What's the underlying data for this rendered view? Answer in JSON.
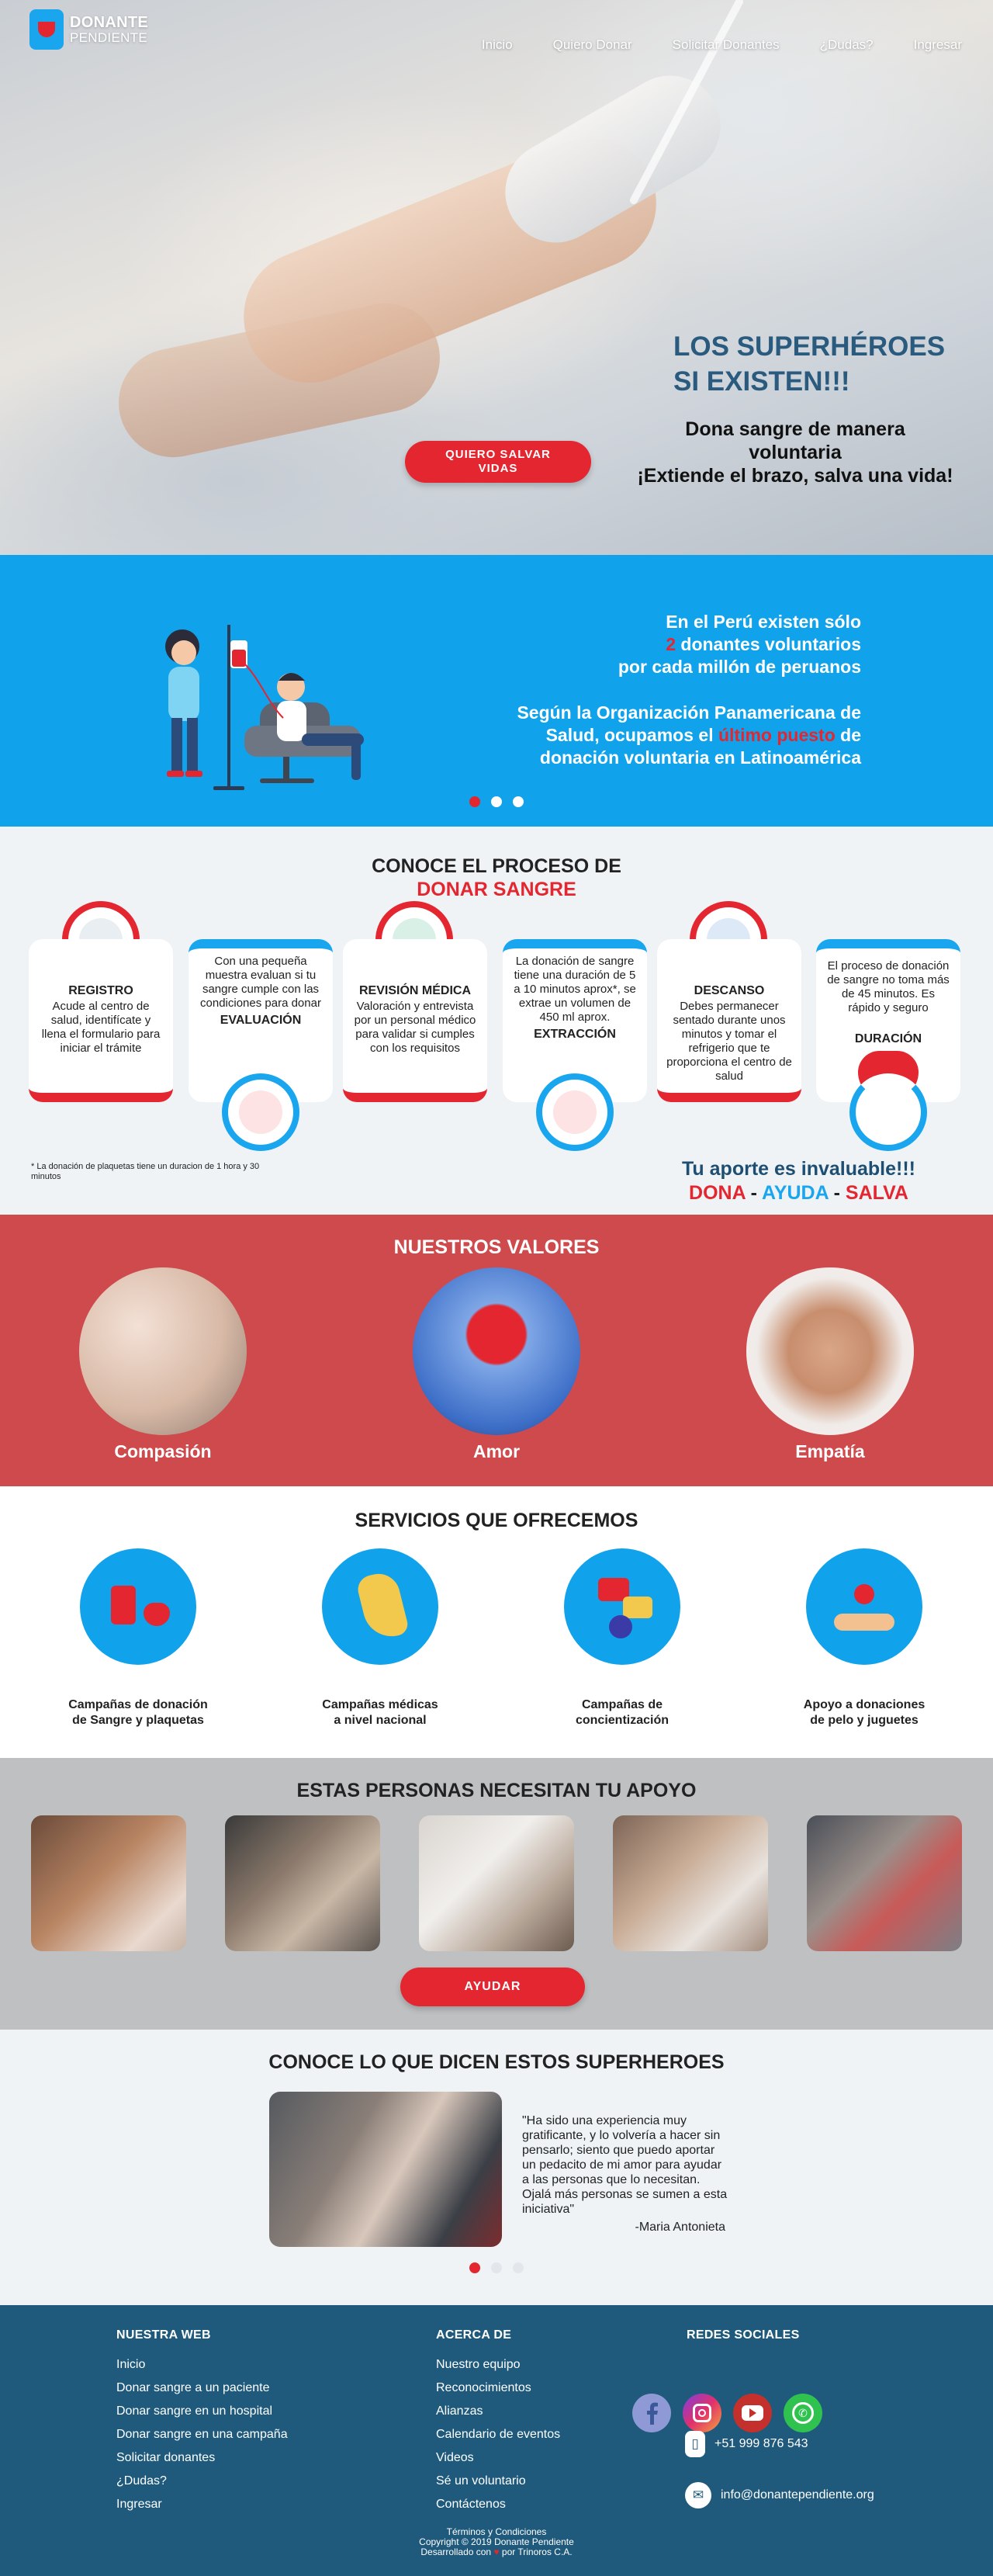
{
  "brand": {
    "line1": "DONANTE",
    "line2": "PENDIENTE"
  },
  "nav": [
    "Inicio",
    "Quiero Donar",
    "Solicitar Donantes",
    "¿Dudas?",
    "Ingresar"
  ],
  "hero": {
    "title_l1": "LOS SUPERHÉROES",
    "title_l2": "SI EXISTEN!!!",
    "sub_l1": "Dona sangre de manera",
    "sub_l2": "voluntaria",
    "sub_l3": "¡Extiende el brazo, salva una vida!",
    "button_l1": "QUIERO SALVAR",
    "button_l2": "VIDAS"
  },
  "stats": {
    "p1_a": "En el Perú existen sólo",
    "p1_num": "2",
    "p1_b": " donantes voluntarios",
    "p1_c": "por cada millón de peruanos",
    "p2_a": "Según la Organización Panamericana de",
    "p2_b": "Salud, ocupamos el ",
    "p2_hl": "último puesto",
    "p2_c": " de",
    "p2_d": "donación voluntaria en Latinoamérica"
  },
  "process": {
    "title_l1": "CONOCE EL PROCESO DE",
    "title_l2": "DONAR SANGRE",
    "steps": [
      {
        "title": "REGISTRO",
        "text": "Acude al centro de salud, identifícate y llena el formulario para iniciar el trámite"
      },
      {
        "title": "EVALUACIÓN",
        "text": "Con una pequeña muestra evaluan si tu sangre cumple con las condiciones para donar"
      },
      {
        "title": "REVISIÓN MÉDICA",
        "text": "Valoración y entrevista por un personal médico para validar si cumples con los requisitos"
      },
      {
        "title": "EXTRACCIÓN",
        "text": "La donación de sangre tiene una duración de 5 a 10 minutos aprox*, se extrae un volumen de 450 ml aprox."
      },
      {
        "title": "DESCANSO",
        "text": "Debes permanecer sentado durante unos minutos y tomar el refrigerio que te proporciona el centro de salud"
      },
      {
        "title": "DURACIÓN",
        "text": "El proceso de donación de sangre no toma más de 45 minutos. Es rápido y seguro"
      }
    ],
    "note": "* La donación de plaquetas tiene un duracion de 1 hora y 30 minutos",
    "aporte_l1": "Tu aporte es invaluable!!!",
    "aporte_w1": "DONA",
    "aporte_w2": "AYUDA",
    "aporte_w3": "SALVA",
    "aporte_sep": " - "
  },
  "values": {
    "title": "NUESTROS VALORES",
    "items": [
      "Compasión",
      "Amor",
      "Empatía"
    ]
  },
  "services": {
    "title": "SERVICIOS QUE OFRECEMOS",
    "items": [
      {
        "l1": "Campañas de donación",
        "l2": "de Sangre y plaquetas"
      },
      {
        "l1": "Campañas médicas",
        "l2": "a nivel nacional"
      },
      {
        "l1": "Campañas de",
        "l2": "concientización"
      },
      {
        "l1": "Apoyo a donaciones",
        "l2": "de pelo y juguetes"
      }
    ]
  },
  "people": {
    "title": "ESTAS PERSONAS NECESITAN TU APOYO",
    "button": "AYUDAR"
  },
  "testimonials": {
    "title": "CONOCE LO QUE DICEN ESTOS SUPERHEROES",
    "quote": "\"Ha sido una experiencia muy gratificante, y lo volvería a hacer sin pensarlo; siento que puedo aportar un pedacito de mi amor para ayudar a las personas que lo necesitan. Ojalá más personas se sumen a esta iniciativa\"",
    "author": "-Maria Antonieta"
  },
  "footer": {
    "col1_title": "NUESTRA WEB",
    "col1": [
      "Inicio",
      "Donar sangre a un paciente",
      "Donar sangre en un hospital",
      "Donar sangre en una campaña",
      "Solicitar donantes",
      "¿Dudas?",
      "Ingresar"
    ],
    "col2_title": "ACERCA DE",
    "col2": [
      "Nuestro equipo",
      "Reconocimientos",
      "Alianzas",
      "Calendario de eventos",
      "Videos",
      "Sé un voluntario",
      "Contáctenos"
    ],
    "col3_title": "REDES SOCIALES",
    "phone": "+51 999 876 543",
    "email": "info@donantependiente.org",
    "legal_l1": "Términos y Condiciones",
    "legal_l2": "Copyright © 2019 Donante Pendiente",
    "legal_l3a": "Desarrollado con ",
    "legal_l3b": " por Trinoros C.A."
  },
  "colors": {
    "red": "#e3262f",
    "blue": "#11a2ec",
    "navy": "#1f5a7c",
    "values_bg": "#cf4a4d",
    "light_bg": "#eff3f6",
    "gray_bg": "#bfc0c2"
  },
  "icons": [
    "facebook-icon",
    "instagram-icon",
    "youtube-icon",
    "whatsapp-icon",
    "phone-icon",
    "mail-icon",
    "heart-icon"
  ]
}
